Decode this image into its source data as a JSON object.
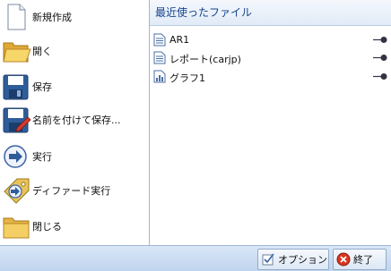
{
  "menu": {
    "items": [
      {
        "label": "新規作成",
        "icon": "new-document-icon"
      },
      {
        "label": "開く",
        "icon": "open-folder-icon"
      },
      {
        "label": "保存",
        "icon": "save-floppy-icon"
      },
      {
        "label": "名前を付けて保存...",
        "icon": "save-as-icon"
      },
      {
        "label": "実行",
        "icon": "run-arrow-icon"
      },
      {
        "label": "ディファード実行",
        "icon": "deferred-run-icon"
      },
      {
        "label": "閉じる",
        "icon": "close-folder-icon"
      }
    ]
  },
  "recent": {
    "title": "最近使ったファイル",
    "files": [
      {
        "name": "AR1",
        "icon": "document-icon"
      },
      {
        "name": "レポート(carjp)",
        "icon": "document-icon"
      },
      {
        "name": "グラフ1",
        "icon": "chart-document-icon"
      }
    ]
  },
  "footer": {
    "options_label": "オプション",
    "exit_label": "終了"
  },
  "colors": {
    "accent": "#15428b",
    "panel_bg": "#c8dcf2",
    "exit_red": "#d9361f"
  }
}
